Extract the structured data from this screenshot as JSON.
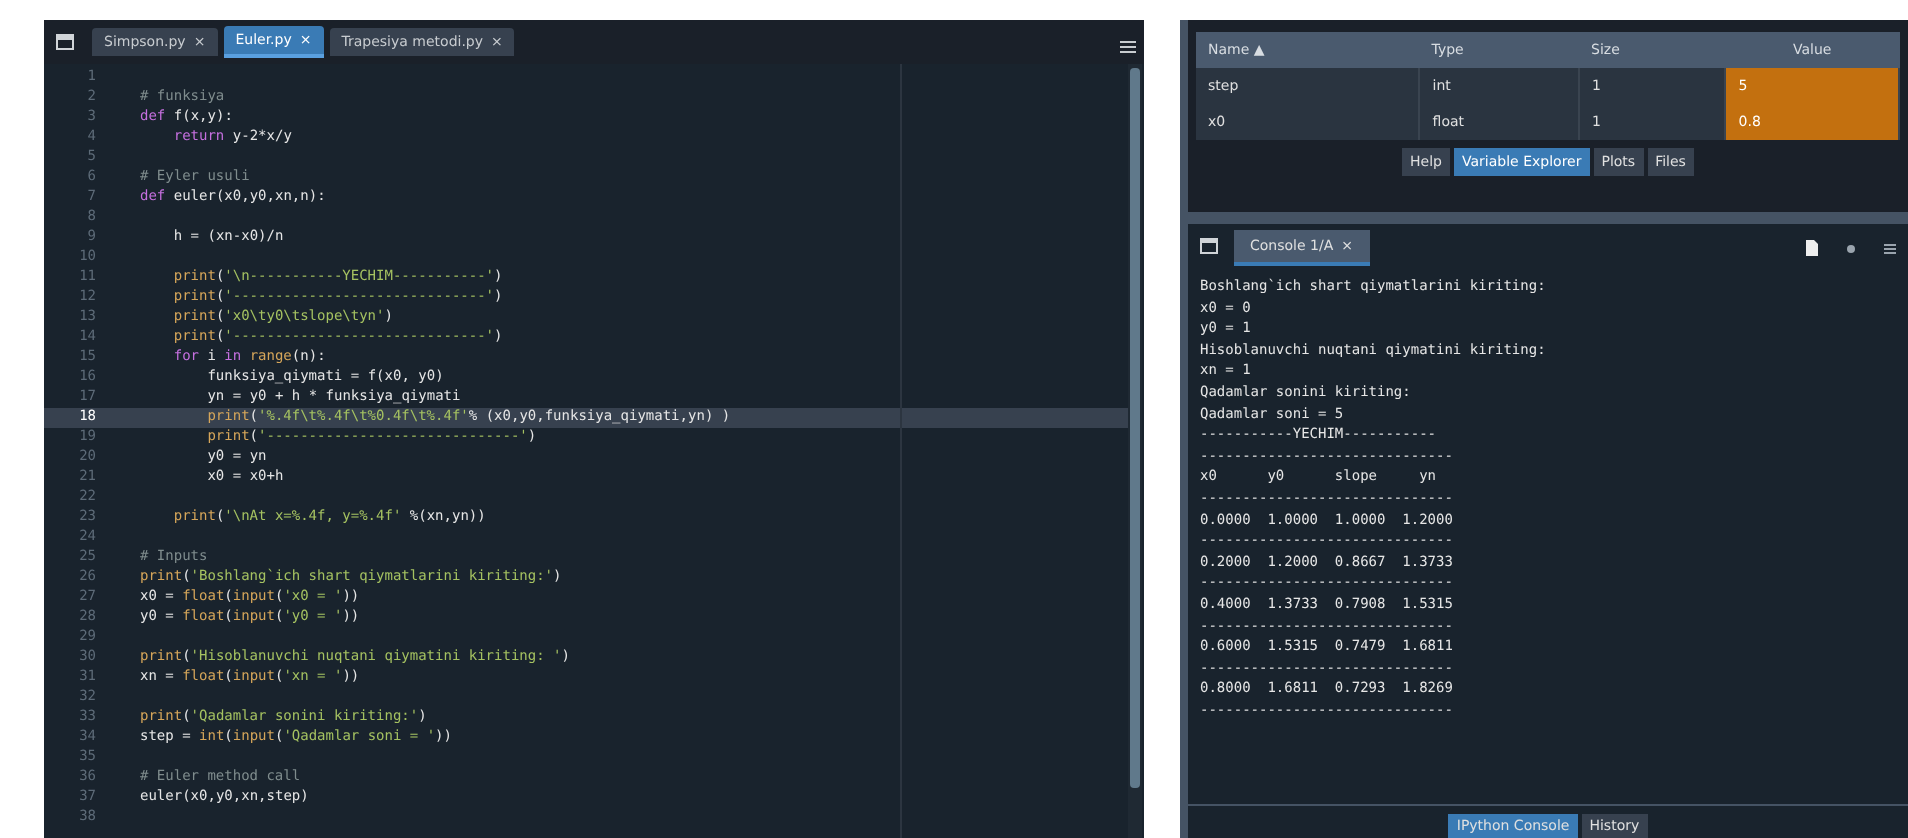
{
  "editor": {
    "tabs": [
      {
        "label": "Simpson.py",
        "close": "×",
        "selected": false
      },
      {
        "label": "Euler.py",
        "close": "×",
        "selected": true
      },
      {
        "label": "Trapesiya metodi.py",
        "close": "×",
        "selected": false
      }
    ],
    "lines": [
      {
        "number": "1",
        "current": false
      },
      {
        "number": "2",
        "text": "# funksiya",
        "current": false
      },
      {
        "number": "3",
        "text": "def f(x,y):",
        "current": false
      },
      {
        "number": "4",
        "text": "    return y-2*x/y",
        "current": false
      },
      {
        "number": "5",
        "current": false
      },
      {
        "number": "6",
        "text": "# Eyler usuli",
        "current": false
      },
      {
        "number": "7",
        "text": "def euler(x0,y0,xn,n):",
        "current": false
      },
      {
        "number": "8",
        "current": false
      },
      {
        "number": "9",
        "text": "    h = (xn-x0)/n",
        "current": false
      },
      {
        "number": "10",
        "current": false
      },
      {
        "number": "11",
        "text": "    print('\\n-----------YECHIM-----------')",
        "current": false
      },
      {
        "number": "12",
        "text": "    print('------------------------------')",
        "current": false
      },
      {
        "number": "13",
        "text": "    print('x0\\ty0\\tslope\\tyn')",
        "current": false
      },
      {
        "number": "14",
        "text": "    print('------------------------------')",
        "current": false
      },
      {
        "number": "15",
        "text": "    for i in range(n):",
        "current": false
      },
      {
        "number": "16",
        "text": "        funksiya_qiymati = f(x0, y0)",
        "current": false
      },
      {
        "number": "17",
        "text": "        yn = y0 + h * funksiya_qiymati",
        "current": false
      },
      {
        "number": "18",
        "text": "        print('%.4f\\t%.4f\\t%0.4f\\t%.4f'% (x0,y0,funksiya_qiymati,yn) )",
        "current": true
      },
      {
        "number": "19",
        "text": "        print('------------------------------')",
        "current": false
      },
      {
        "number": "20",
        "text": "        y0 = yn",
        "current": false
      },
      {
        "number": "21",
        "text": "        x0 = x0+h",
        "current": false
      },
      {
        "number": "22",
        "current": false
      },
      {
        "number": "23",
        "text": "    print('\\nAt x=%.4f, y=%.4f' %(xn,yn))",
        "current": false
      },
      {
        "number": "24",
        "current": false
      },
      {
        "number": "25",
        "text": "# Inputs",
        "current": false
      },
      {
        "number": "26",
        "text": "print('Boshlang`ich shart qiymatlarini kiriting:')",
        "current": false
      },
      {
        "number": "27",
        "text": "x0 = float(input('x0 = '))",
        "current": false
      },
      {
        "number": "28",
        "text": "y0 = float(input('y0 = '))",
        "current": false
      },
      {
        "number": "29",
        "current": false
      },
      {
        "number": "30",
        "text": "print('Hisoblanuvchi nuqtani qiymatini kiriting: ')",
        "current": false
      },
      {
        "number": "31",
        "text": "xn = float(input('xn = '))",
        "current": false
      },
      {
        "number": "32",
        "current": false
      },
      {
        "number": "33",
        "text": "print('Qadamlar sonini kiriting:')",
        "current": false
      },
      {
        "number": "34",
        "text": "step = int(input('Qadamlar soni = '))",
        "current": false
      },
      {
        "number": "35",
        "current": false
      },
      {
        "number": "36",
        "text": "# Euler method call",
        "current": false
      },
      {
        "number": "37",
        "text": "euler(x0,y0,xn,step)",
        "current": false
      },
      {
        "number": "38",
        "current": false
      }
    ]
  },
  "variable_explorer": {
    "columns": [
      "Name ▲",
      "Type",
      "Size",
      "Value"
    ],
    "rows": [
      {
        "cells": [
          "step",
          "int",
          "1",
          "5"
        ]
      },
      {
        "cells": [
          "x0",
          "float",
          "1",
          "0.8"
        ]
      }
    ],
    "tabs": [
      {
        "label": "Help",
        "selected": false
      },
      {
        "label": "Variable Explorer",
        "selected": true
      },
      {
        "label": "Plots",
        "selected": false
      },
      {
        "label": "Files",
        "selected": false
      }
    ]
  },
  "console": {
    "tabs": [
      {
        "label": "Console 1/A",
        "close": "×",
        "selected": true
      }
    ],
    "lines": [
      "Boshlang`ich shart qiymatlarini kiriting:",
      "x0 = 0",
      "y0 = 1",
      "Hisoblanuvchi nuqtani qiymatini kiriting:",
      "xn = 1",
      "Qadamlar sonini kiriting:",
      "Qadamlar soni = 5",
      "-----------YECHIM-----------",
      "------------------------------",
      "x0      y0      slope     yn",
      "------------------------------",
      "0.0000  1.0000  1.0000  1.2000",
      "------------------------------",
      "0.2000  1.2000  0.8667  1.3733",
      "------------------------------",
      "0.4000  1.3733  0.7908  1.5315",
      "------------------------------",
      "0.6000  1.5315  0.7479  1.6811",
      "------------------------------",
      "0.8000  1.6811  0.7293  1.8269",
      "------------------------------"
    ],
    "bottom_tabs": [
      {
        "label": "IPython Console",
        "selected": true
      },
      {
        "label": "History",
        "selected": false
      }
    ]
  }
}
